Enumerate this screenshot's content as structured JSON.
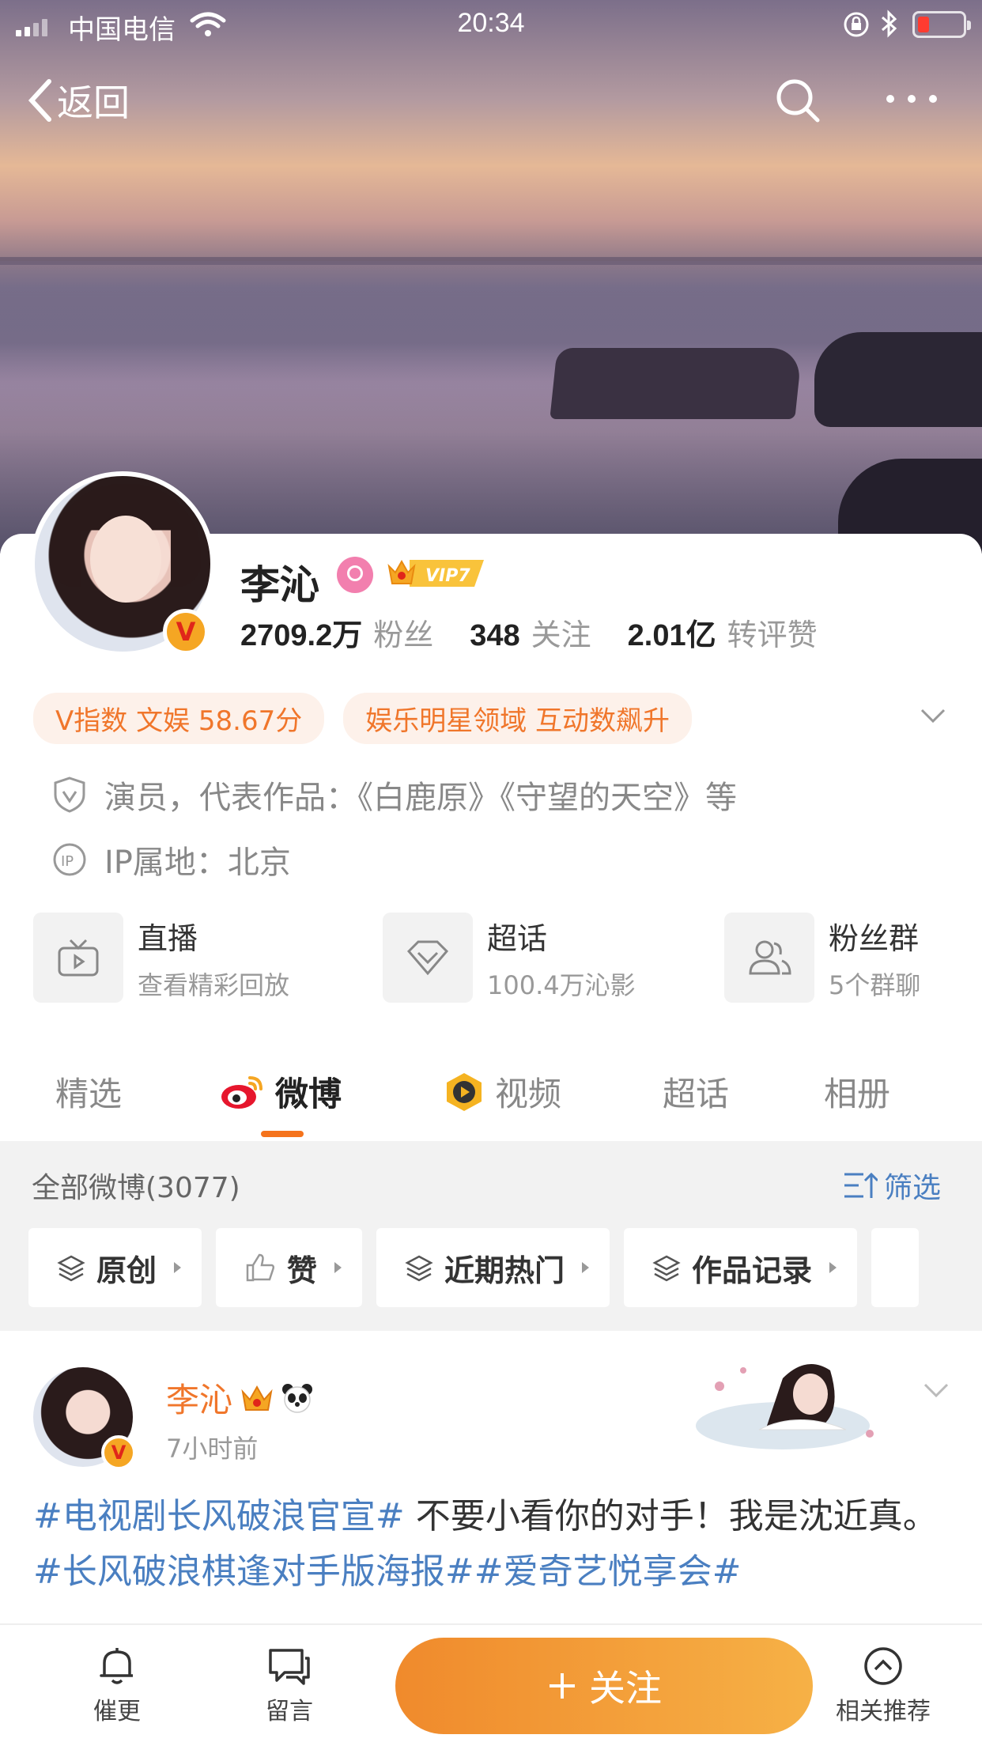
{
  "status_bar": {
    "carrier": "中国电信",
    "time": "20:34"
  },
  "nav": {
    "back_label": "返回"
  },
  "profile": {
    "name": "李沁",
    "vip_label": "VIP7",
    "verified_mark": "V",
    "stats": [
      {
        "num": "2709.2万",
        "label": "粉丝"
      },
      {
        "num": "348",
        "label": "关注"
      },
      {
        "num": "2.01亿",
        "label": "转评赞"
      }
    ],
    "tags": [
      "V指数 文娱 58.67分",
      "娱乐明星领域 互动数飙升"
    ],
    "desc": "演员，代表作品：《白鹿原》《守望的天空》等",
    "ip": "IP属地：北京"
  },
  "features": [
    {
      "title": "直播",
      "sub": "查看精彩回放",
      "icon": "tv-icon"
    },
    {
      "title": "超话",
      "sub": "100.4万沁影",
      "icon": "diamond-icon"
    },
    {
      "title": "粉丝群",
      "sub": "5个群聊",
      "icon": "group-icon"
    }
  ],
  "tabs": [
    "精选",
    "微博",
    "视频",
    "超话",
    "相册"
  ],
  "filter": {
    "all_label": "全部微博(3077)",
    "filter_label": "筛选",
    "chips": [
      "原创",
      "赞",
      "近期热门",
      "作品记录"
    ]
  },
  "post": {
    "author": "李沁",
    "time": "7小时前",
    "hashtag1": "#电视剧长风破浪官宣#",
    "text1": " 不要小看你的对手！我是沈近真。",
    "hashtag2": "#长风破浪棋逢对手版海报##爱奇艺悦享会#"
  },
  "bottom": {
    "urge": "催更",
    "message": "留言",
    "follow": "关注",
    "related": "相关推荐"
  },
  "colors": {
    "accent": "#f0762b",
    "link": "#4a7fc1",
    "follow_start": "#f08a2c",
    "follow_end": "#f6b146"
  }
}
